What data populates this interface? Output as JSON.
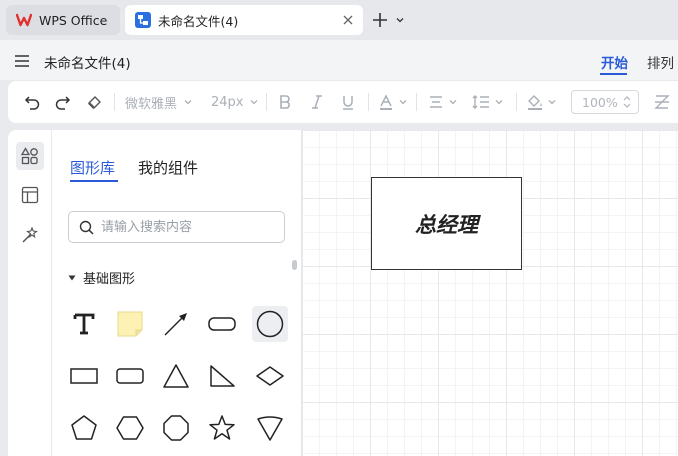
{
  "tabs": [
    {
      "label": "WPS Office"
    },
    {
      "label": "未命名文件(4)"
    }
  ],
  "header": {
    "doc_title": "未命名文件(4)",
    "ribbon_tabs": [
      {
        "label": "开始",
        "active": true
      },
      {
        "label": "排列",
        "active": false
      }
    ]
  },
  "toolbar": {
    "font_family": "微软雅黑",
    "font_size": "24px",
    "zoom": "100%"
  },
  "panel": {
    "tabs": [
      {
        "label": "图形库",
        "active": true
      },
      {
        "label": "我的组件",
        "active": false
      }
    ],
    "search_placeholder": "请输入搜索内容",
    "section_title": "基础图形",
    "shapes": [
      "text",
      "note",
      "arrow",
      "rounded-rectangle",
      "circle",
      "rectangle",
      "rounded-rectangle-small",
      "triangle",
      "right-triangle",
      "diamond",
      "pentagon",
      "hexagon",
      "octagon",
      "star",
      "inverted-pentagon"
    ]
  },
  "canvas": {
    "node_label": "总经理"
  },
  "colors": {
    "accent": "#2a5bd7",
    "wps_red": "#e0312f",
    "note_yellow": "#fdf2b3"
  }
}
